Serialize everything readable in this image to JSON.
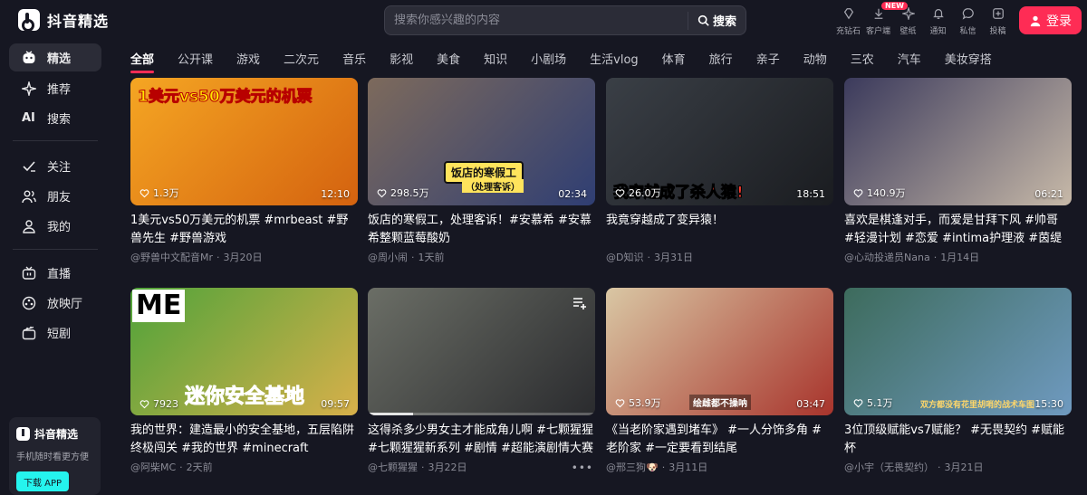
{
  "app": {
    "logo_text": "抖音精选"
  },
  "search": {
    "placeholder": "搜索你感兴趣的内容",
    "button_label": "搜索"
  },
  "header_tools": [
    {
      "label": "充钻石",
      "icon": "diamond-icon"
    },
    {
      "label": "客户端",
      "icon": "download-icon",
      "badge": "NEW"
    },
    {
      "label": "壁纸",
      "icon": "sparkle-icon"
    },
    {
      "label": "通知",
      "icon": "bell-icon"
    },
    {
      "label": "私信",
      "icon": "message-icon"
    },
    {
      "label": "投稿",
      "icon": "plus-square-icon"
    }
  ],
  "login": {
    "label": "登录"
  },
  "sidebar": {
    "items": [
      {
        "label": "精选",
        "icon": "home-icon",
        "active": true
      },
      {
        "label": "推荐",
        "icon": "star-icon"
      },
      {
        "label": "搜索",
        "icon": "ai-icon",
        "prefix": "AI"
      },
      {
        "label": "关注",
        "icon": "follow-icon"
      },
      {
        "label": "朋友",
        "icon": "friends-icon"
      },
      {
        "label": "我的",
        "icon": "user-icon"
      },
      {
        "label": "直播",
        "icon": "tv-icon"
      },
      {
        "label": "放映厅",
        "icon": "film-reel-icon"
      },
      {
        "label": "短剧",
        "icon": "clapper-icon"
      }
    ],
    "promo": {
      "title": "抖音精选",
      "subtitle": "手机随时看更方便",
      "button": "下载 APP"
    }
  },
  "categories": [
    "全部",
    "公开课",
    "游戏",
    "二次元",
    "音乐",
    "影视",
    "美食",
    "知识",
    "小剧场",
    "生活vlog",
    "体育",
    "旅行",
    "亲子",
    "动物",
    "三农",
    "汽车",
    "美妆穿搭"
  ],
  "active_category": "全部",
  "videos": [
    {
      "likes": "1.3万",
      "duration": "12:10",
      "title": "1美元vs50万美元的机票 #mrbeast #野兽先生 #野兽游戏",
      "author": "@野兽中文配音Mr",
      "date": "3月20日",
      "overlay": "1美元vs50万美元的机票",
      "colors": [
        "#f5a623",
        "#d4620f"
      ]
    },
    {
      "likes": "298.5万",
      "duration": "02:34",
      "title": "饭店的寒假工，处理客诉！#安慕希 #安慕希整颗蓝莓酸奶",
      "author": "@周小闹",
      "date": "1天前",
      "overlay": "饭店的寒假工",
      "overlay_sub": "（处理客诉）",
      "colors": [
        "#7d6a5c",
        "#2f3e73"
      ]
    },
    {
      "likes": "26.0万",
      "duration": "18:51",
      "title": "我竟穿越成了变异猿！",
      "author": "@D知识",
      "date": "3月31日",
      "overlay": "我穿越成了杀人猿!",
      "colors": [
        "#3a3f46",
        "#1a1c20"
      ]
    },
    {
      "likes": "140.9万",
      "duration": "06:21",
      "title": "喜欢是棋逢对手，而爱是甘拜下风 #帅哥 #轻漫计划 #恋爱 #intima护理液 #茵缇玛",
      "author": "@心动投递员Nana",
      "date": "1月14日",
      "colors": [
        "#3b3a5c",
        "#c7b9a8"
      ]
    },
    {
      "likes": "7923",
      "duration": "09:57",
      "title": "我的世界：建造最小的安全基地，五层陷阱终极闯关 #我的世界 #minecraft",
      "author": "@阿柴MC",
      "date": "2天前",
      "overlay": "迷你安全基地",
      "overlay_tl": "ME",
      "colors": [
        "#4fa33a",
        "#d8b04a"
      ]
    },
    {
      "likes": "",
      "duration": "",
      "title": "这得杀多少男女主才能成角儿啊 #七颗猩猩 #七颗猩猩新系列 #剧情 #超能演剧情大赛",
      "author": "@七颗猩猩",
      "date": "3月22日",
      "progress": 0.2,
      "colors": [
        "#6b6e66",
        "#2a2b2e"
      ]
    },
    {
      "likes": "53.9万",
      "duration": "03:47",
      "title": "《当老阶家遇到堵车》 #一人分饰多角 #老阶家 #一定要看到结尾",
      "author": "@邢三狗🐶",
      "date": "3月11日",
      "overlay": "绘雌都不操呐",
      "colors": [
        "#d9c7a4",
        "#a8342c"
      ]
    },
    {
      "likes": "5.1万",
      "duration": "15:30",
      "title": "3位顶级赋能vs7赋能？ #无畏契约 #赋能杯",
      "author": "@小宇（无畏契约）",
      "date": "3月21日",
      "overlay": "双方都没有花里胡哨的战术车图",
      "colors": [
        "#3d6b5c",
        "#6f9ac0"
      ]
    }
  ]
}
